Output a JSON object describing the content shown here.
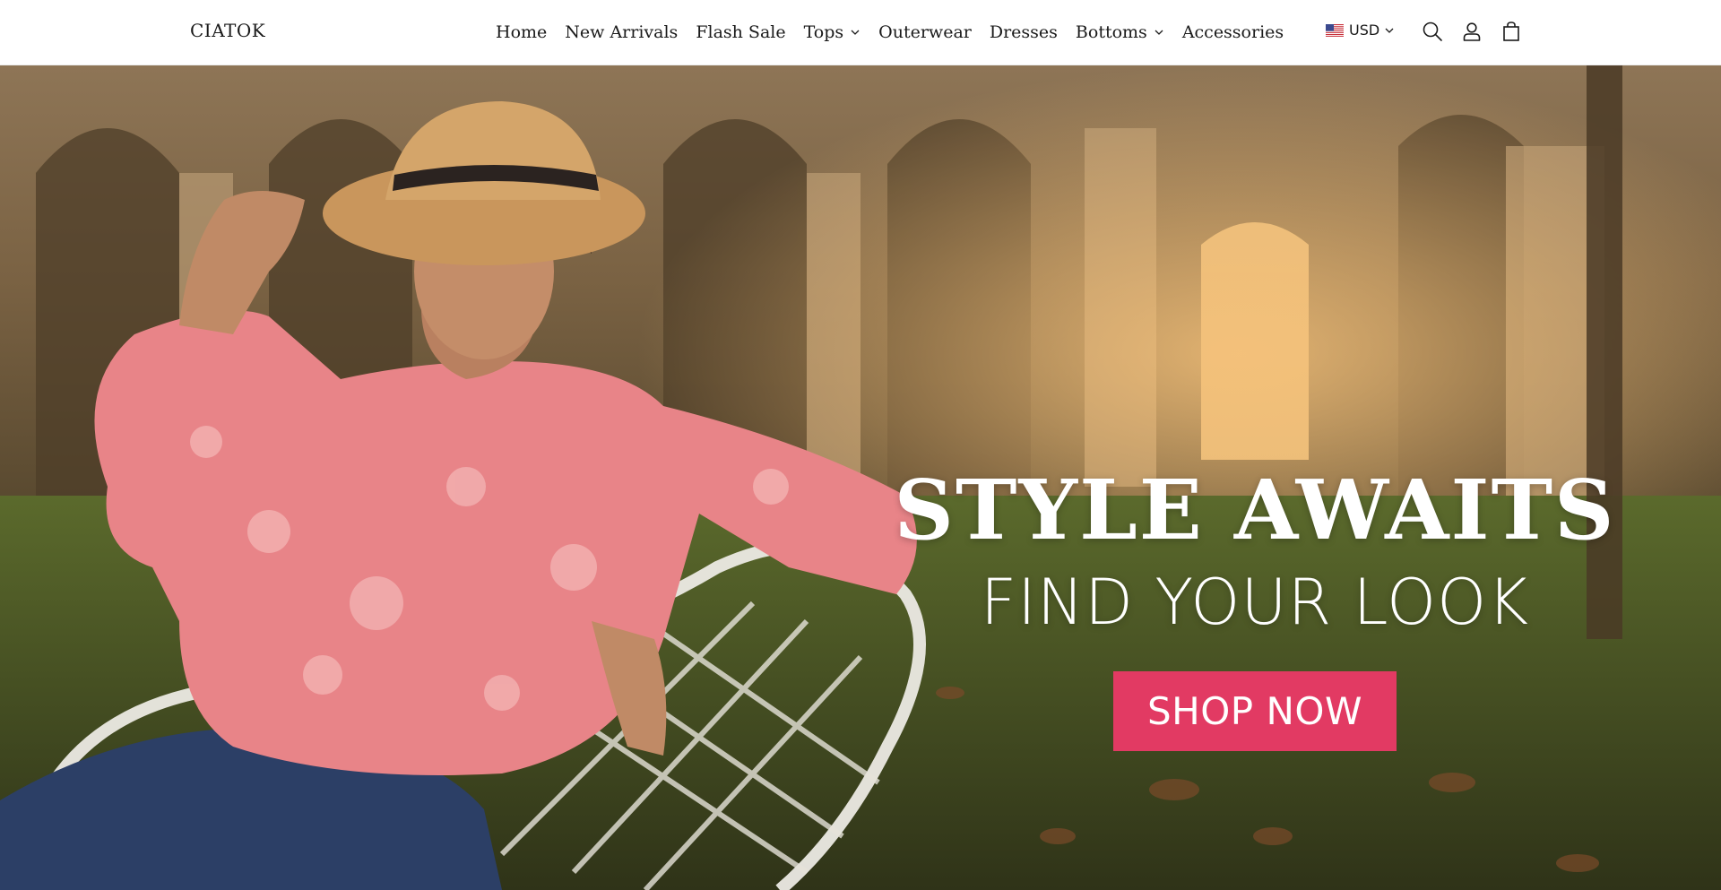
{
  "header": {
    "logo": "CIATOK",
    "nav": [
      {
        "label": "Home"
      },
      {
        "label": "New Arrivals"
      },
      {
        "label": "Flash Sale"
      },
      {
        "label": "Tops",
        "has_dropdown": true
      },
      {
        "label": "Outerwear"
      },
      {
        "label": "Dresses"
      },
      {
        "label": "Bottoms",
        "has_dropdown": true
      },
      {
        "label": "Accessories"
      }
    ],
    "currency": {
      "label": "USD",
      "flag_icon": "us-flag-icon"
    },
    "icons": [
      "search-icon",
      "account-icon",
      "cart-icon"
    ]
  },
  "hero": {
    "headline": "STYLE AWAITS",
    "subheadline": "FIND YOUR LOOK",
    "cta_label": "SHOP NOW",
    "image": "hero-image-model-in-pink-blouse-on-wicker-chair",
    "colors": {
      "cta_background": "#e23a63",
      "cta_text": "#ffffff",
      "headline_text": "#ffffff"
    }
  }
}
